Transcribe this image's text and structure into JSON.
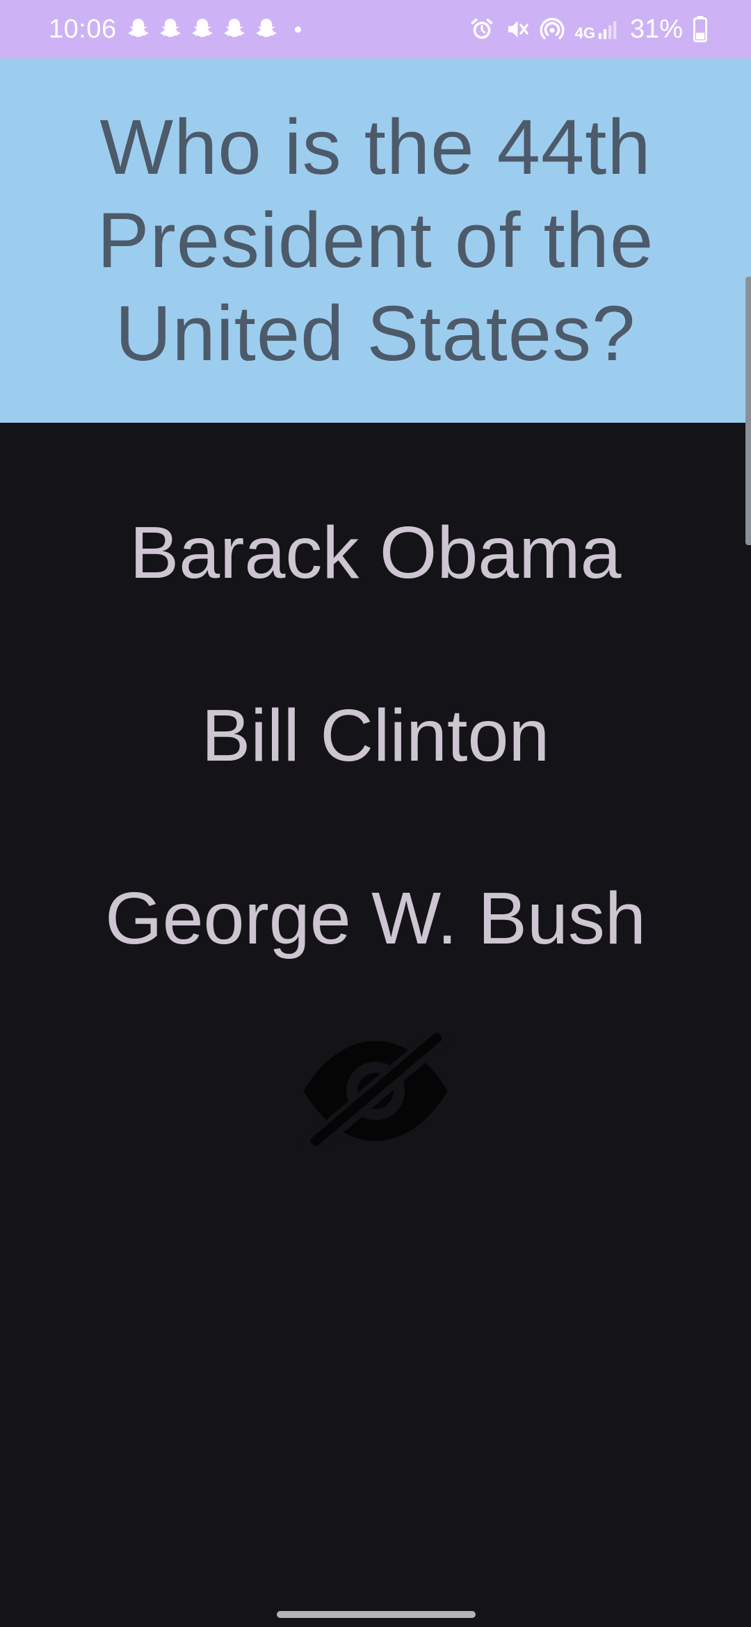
{
  "status_bar": {
    "time": "10:06",
    "notification_icons": [
      "snapchat-icon",
      "snapchat-icon",
      "snapchat-icon",
      "snapchat-icon",
      "snapchat-icon"
    ],
    "network_label": "4G",
    "battery_percent": "31%",
    "background_color": "#cdb3f5"
  },
  "question": {
    "text": "Who is the 44th President of the United States?",
    "background_color": "#9dcdee",
    "text_color": "#4d5a6a"
  },
  "answers": [
    {
      "label": "Barack Obama"
    },
    {
      "label": "Bill Clinton"
    },
    {
      "label": "George W. Bush"
    }
  ],
  "hide_toggle_icon": "eye-off-icon",
  "colors": {
    "page_background": "#141317",
    "answer_text": "#cdc6d2"
  }
}
